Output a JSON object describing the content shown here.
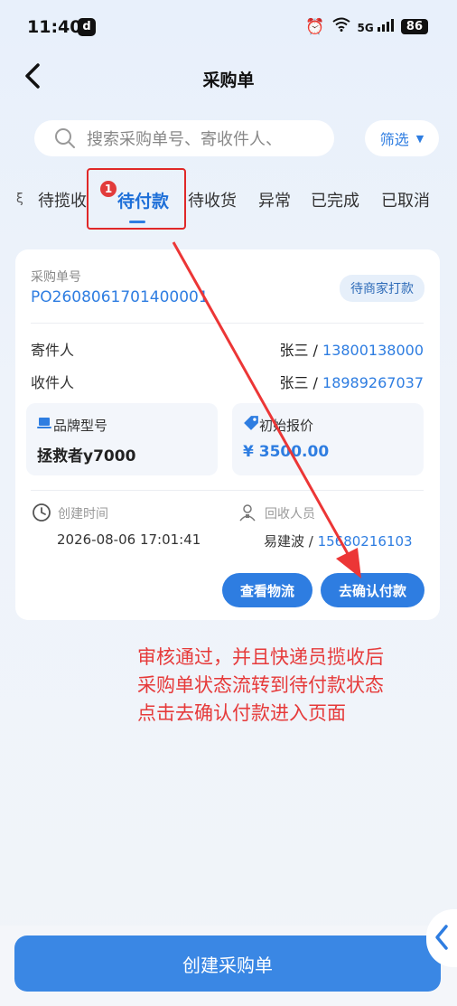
{
  "status_bar": {
    "time": "11:40",
    "tiktok": "d",
    "signal": "5G",
    "battery": "86"
  },
  "nav": {
    "title": "采购单"
  },
  "search": {
    "placeholder": "搜索采购单号、寄收件人、",
    "filter_label": "筛选",
    "filter_caret": "▼"
  },
  "tabs": [
    {
      "label": "待揽收"
    },
    {
      "label": "待付款",
      "active": true,
      "badge": "1"
    },
    {
      "label": "待收货"
    },
    {
      "label": "异常"
    },
    {
      "label": "已完成"
    },
    {
      "label": "已取消"
    }
  ],
  "order": {
    "order_no_label": "采购单号",
    "order_no": "PO2608061701400001",
    "status": "待商家打款",
    "sender_label": "寄件人",
    "sender_name": "张三 / ",
    "sender_phone": "13800138000",
    "receiver_label": "收件人",
    "receiver_name": "张三 / ",
    "receiver_phone": "18989267037",
    "model_label": "品牌型号",
    "model_value": "拯救者y7000",
    "price_label": "初始报价",
    "price_value": "¥ 3500.00",
    "created_label": "创建时间",
    "created_value": "2026-08-06 17:01:41",
    "collector_label": "回收人员",
    "collector_name": "易建波 / ",
    "collector_phone": "15680216103",
    "btn_logistics": "查看物流",
    "btn_confirm": "去确认付款"
  },
  "annotation": {
    "line1": "审核通过，并且快递员揽收后",
    "line2": "采购单状态流转到待付款状态",
    "line3": "点击去确认付款进入页面"
  },
  "bottom": {
    "create_button": "创建采购单"
  },
  "colors": {
    "primary": "#2e7de1",
    "annotation": "#e63a3a",
    "badge": "#e23b3b"
  }
}
